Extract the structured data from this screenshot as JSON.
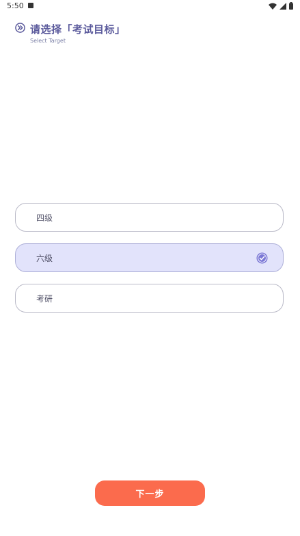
{
  "status_bar": {
    "time": "5:50",
    "icons": [
      "notification-icon",
      "wifi-icon",
      "signal-icon",
      "battery-icon"
    ]
  },
  "header": {
    "icon": "double-chevron-right-icon",
    "title": "请选择「考试目标」",
    "subtitle": "Select Target",
    "title_color": "#5b5a9c"
  },
  "options": [
    {
      "label": "四级",
      "selected": false
    },
    {
      "label": "六级",
      "selected": true
    },
    {
      "label": "考研",
      "selected": false
    }
  ],
  "selection": {
    "check_icon": "check-circle-icon",
    "selected_bg": "#e2e3fb",
    "check_color": "#7b78d6"
  },
  "next_button": {
    "label": "下一步",
    "color": "#fb6b4d"
  }
}
